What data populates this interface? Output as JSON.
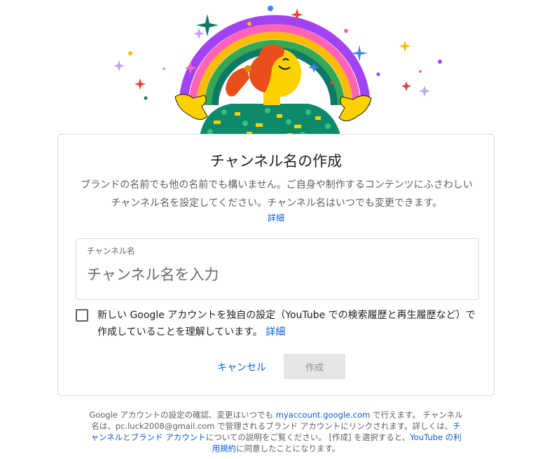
{
  "dialog": {
    "title": "チャンネル名の作成",
    "description": "ブランドの名前でも他の名前でも構いません。ご自身や制作するコンテンツにふさわしいチャンネル名を設定してください。チャンネル名はいつでも変更できます。",
    "details_link": "詳細",
    "field": {
      "label": "チャンネル名",
      "placeholder": "チャンネル名を入力",
      "value": ""
    },
    "checkbox": {
      "checked": false,
      "text": "新しい Google アカウントを独自の設定（YouTube での検索履歴と再生履歴など）で作成していることを理解しています。",
      "link": "詳細"
    },
    "cancel_label": "キャンセル",
    "create_label": "作成"
  },
  "footer": {
    "part1": "Google アカウントの設定の確認、変更はいつでも ",
    "account_link": "myaccount.google.com",
    "part2": " で行えます。 チャンネル名は、pc.luck2008@gmail.com で管理されるブランド アカウントにリンクされます。詳しくは、",
    "channel_link": "チャンネル",
    "part3": "と",
    "brand_link": "ブランド アカウント",
    "part4": "についての説明をご覧ください。 [作成] を選択すると、",
    "terms_link": "YouTube の利用規約",
    "part5": "に同意したことになります。"
  },
  "colors": {
    "link": "#065fd4",
    "rainbow": [
      "#a142f4",
      "#4285f4",
      "#34a853",
      "#fbbc04",
      "#f6ae2d",
      "#ea4335",
      "#ff63b6"
    ],
    "hair": "#ea4e1b",
    "skin": "#fbd100",
    "shirt": "#0d8a6a"
  },
  "icons": {
    "header_illustration": "rainbow-person-illustration",
    "sparkles": "sparkle-icon"
  }
}
